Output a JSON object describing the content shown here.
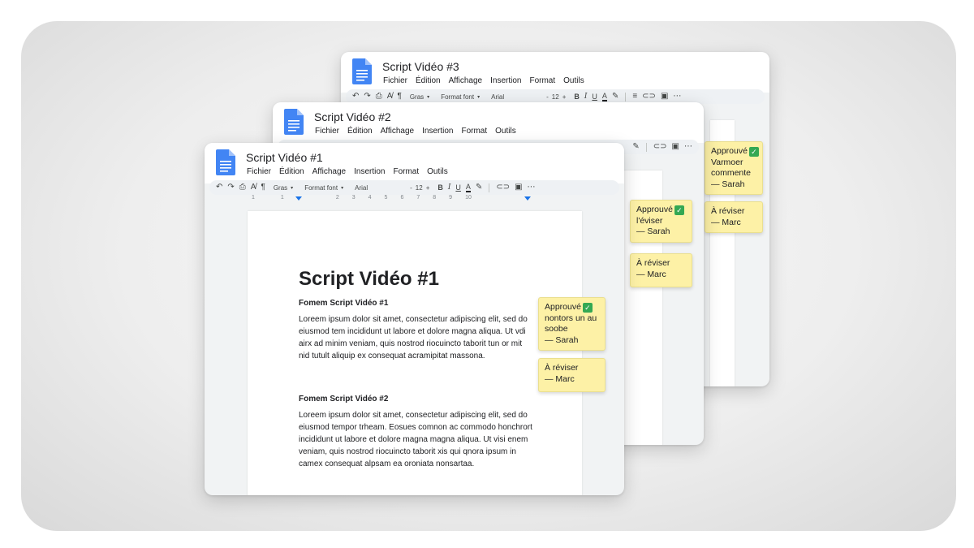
{
  "windows": [
    {
      "title": "Script Vidéo #3",
      "menu": [
        "Fichier",
        "Édition",
        "Affichage",
        "Insertion",
        "Format",
        "Outils"
      ],
      "toolbar": {
        "style": "Gras",
        "format": "Format font",
        "font": "Arial",
        "size": "12"
      },
      "comments": [
        {
          "lines": [
            "Approuvé",
            "Varmoer",
            "commente",
            "— Sarah"
          ],
          "approved": true
        },
        {
          "lines": [
            "À réviser",
            "— Marc"
          ],
          "approved": false
        }
      ]
    },
    {
      "title": "Script Vidéo #2",
      "menu": [
        "Fichier",
        "Édition",
        "Affichage",
        "Insertion",
        "Format",
        "Outils"
      ],
      "comments": [
        {
          "lines": [
            "Approuvé",
            "l'éviser",
            "— Sarah"
          ],
          "approved": true
        },
        {
          "lines": [
            "À réviser",
            "— Marc"
          ],
          "approved": false
        }
      ]
    },
    {
      "title": "Script Vidéo #1",
      "menu": [
        "Fichier",
        "Édition",
        "Affichage",
        "Insertion",
        "Format",
        "Outils"
      ],
      "toolbar": {
        "style": "Gras",
        "format": "Format font",
        "font": "Arial",
        "size": "12"
      },
      "ruler": [
        "1",
        "1",
        "2",
        "3",
        "4",
        "5",
        "6",
        "7",
        "8",
        "9",
        "10"
      ],
      "document": {
        "heading": "Script Vidéo #1",
        "sections": [
          {
            "title": "Fomem Script Vidéo #1",
            "body": "Loreem ipsum dolor sit amet, consectetur adipiscing elit, sed do eiusmod tem incididunt ut labore et dolore magna aliqua. Ut vdi airx ad minim veniam, quis nostrod riocuincto taborit tun or mit nid tutult aliquip ex consequat acramipitat massona."
          },
          {
            "title": "Fomem Script Vidéo #2",
            "body": "Loreem ipsum dolor sit amet, consectetur adipiscing elit, sed do eiusmod tempor trheam. Eosues comnon ac commodo honchrort incididunt ut labore et dolore magna magna aliqua. Ut visi enem veniam, quis nostrod riocuincto taborit xis qui qnora ipsum in camex consequat alpsam ea oroniata nonsartaa."
          }
        ]
      },
      "comments": [
        {
          "lines": [
            "Approuvé",
            "nontors un au",
            "soobe",
            "— Sarah"
          ],
          "approved": true
        },
        {
          "lines": [
            "À réviser",
            "— Marc"
          ],
          "approved": false
        }
      ]
    }
  ],
  "colors": {
    "doc_blue": "#4285f4",
    "note_yellow": "#fdf1a6",
    "check_green": "#34a853"
  },
  "icons": {
    "undo": "↶",
    "redo": "↷",
    "print": "⎙",
    "spell": "A̸",
    "paint": "¶",
    "link": "🔗",
    "image": "▣",
    "more": "⋯"
  }
}
